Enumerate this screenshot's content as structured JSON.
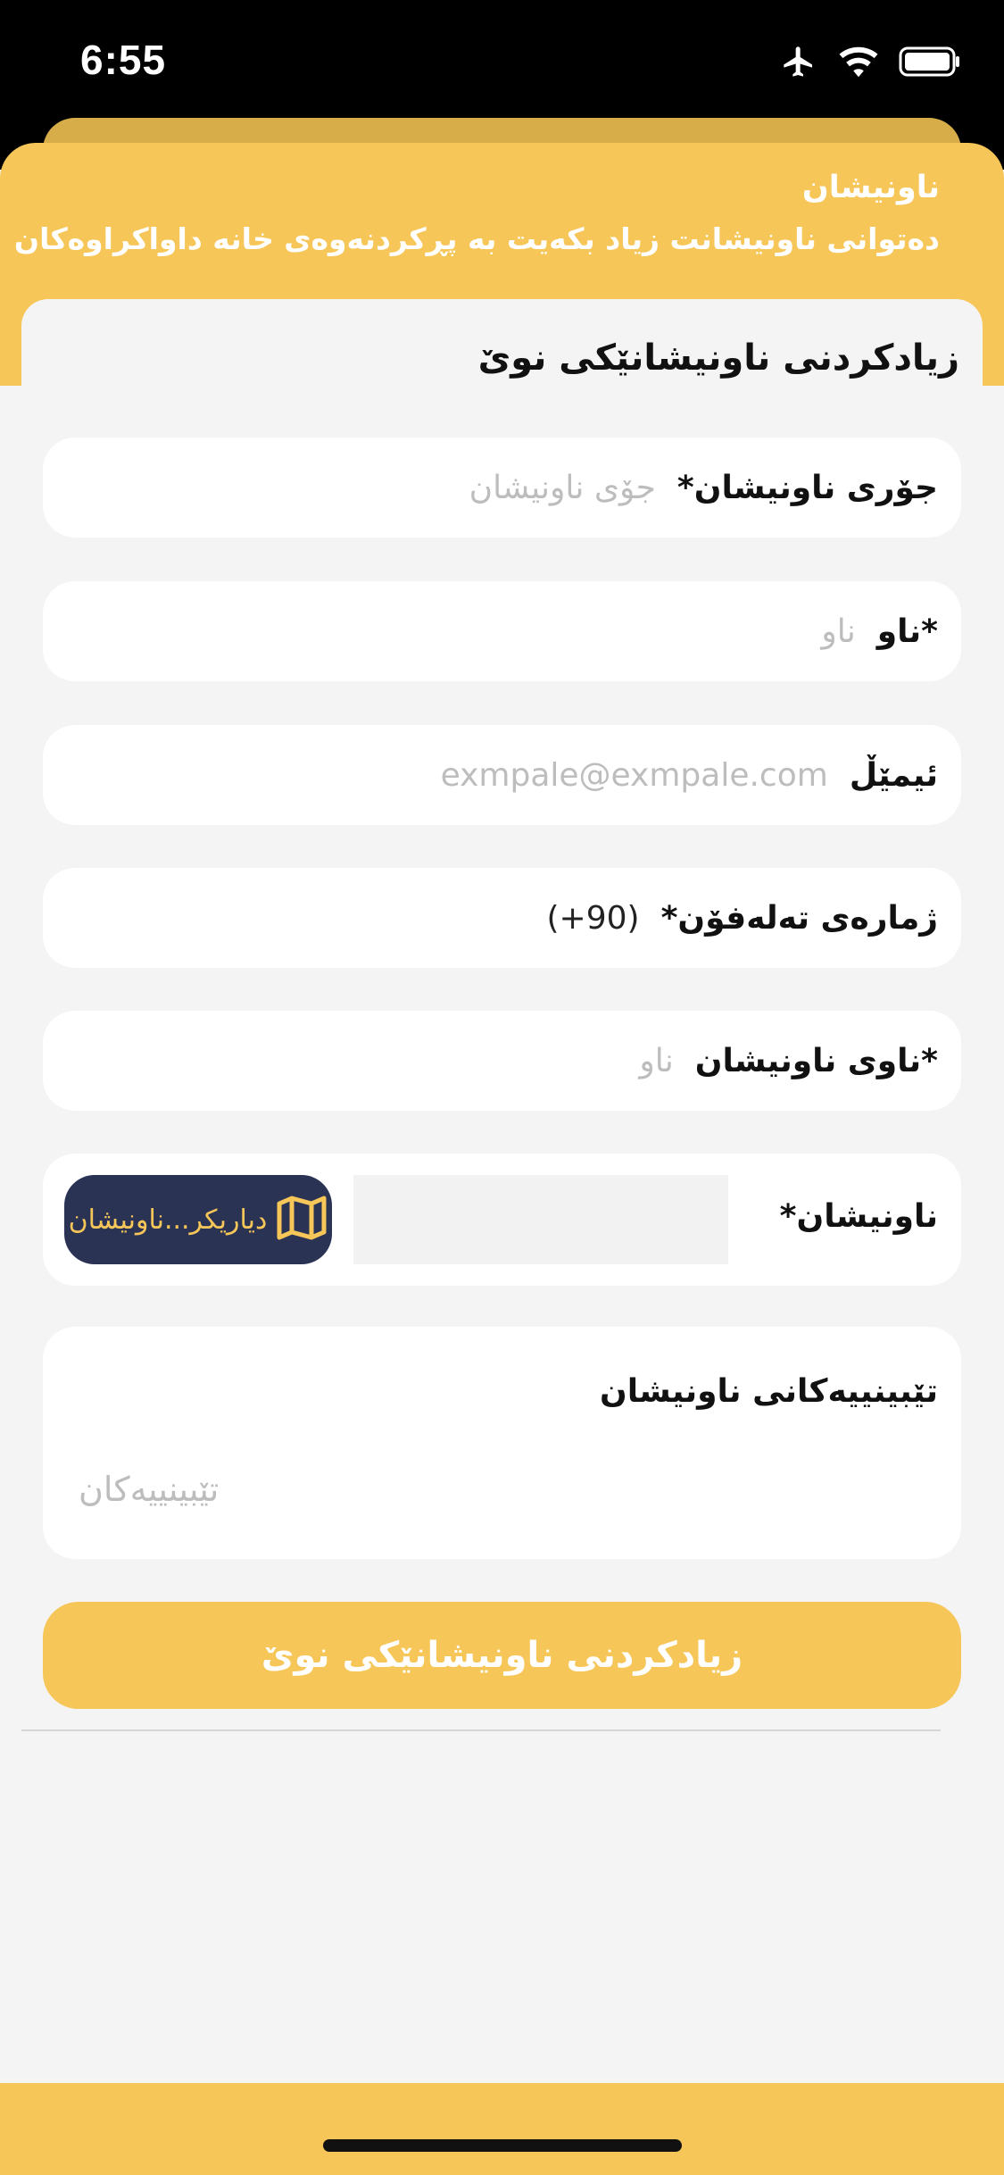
{
  "status_bar": {
    "time": "6:55",
    "icons": [
      "airplane-icon",
      "wifi-icon",
      "battery-icon"
    ]
  },
  "header": {
    "title": "ناونیشان",
    "subtitle": "دەتوانی ناونیشانت زیاد بکەیت بە پڕکردنەوەی خانە داواکراوەکان"
  },
  "form": {
    "title": "زیادکردنی ناونیشانێکی نوێ",
    "fields": {
      "address_type": {
        "label": "جۆری ناونیشان*",
        "placeholder": "جۆی ناونیشان"
      },
      "name": {
        "label": "*ناو",
        "placeholder": "ناو"
      },
      "email": {
        "label": "ئیمێڵ",
        "placeholder": "exmpale@exmpale.com"
      },
      "phone": {
        "label": "ژمارەی تەلەفۆن*",
        "value": "(+90)"
      },
      "address_name": {
        "label": "*ناوی ناونیشان",
        "placeholder": "ناو"
      },
      "address": {
        "label": "ناونیشان*",
        "map_button_label": "دیاریکر...ناونیشان",
        "map_icon": "map-icon"
      },
      "notes": {
        "label": "تێبینییەکانی ناونیشان",
        "placeholder": "تێبینییەکان"
      }
    },
    "submit_label": "زیادکردنی ناونیشانێکی نوێ"
  },
  "colors": {
    "accent": "#f6c659",
    "accent_dark": "#d7ad4a",
    "map_button": "#2b3354",
    "background": "#f4f4f4"
  }
}
